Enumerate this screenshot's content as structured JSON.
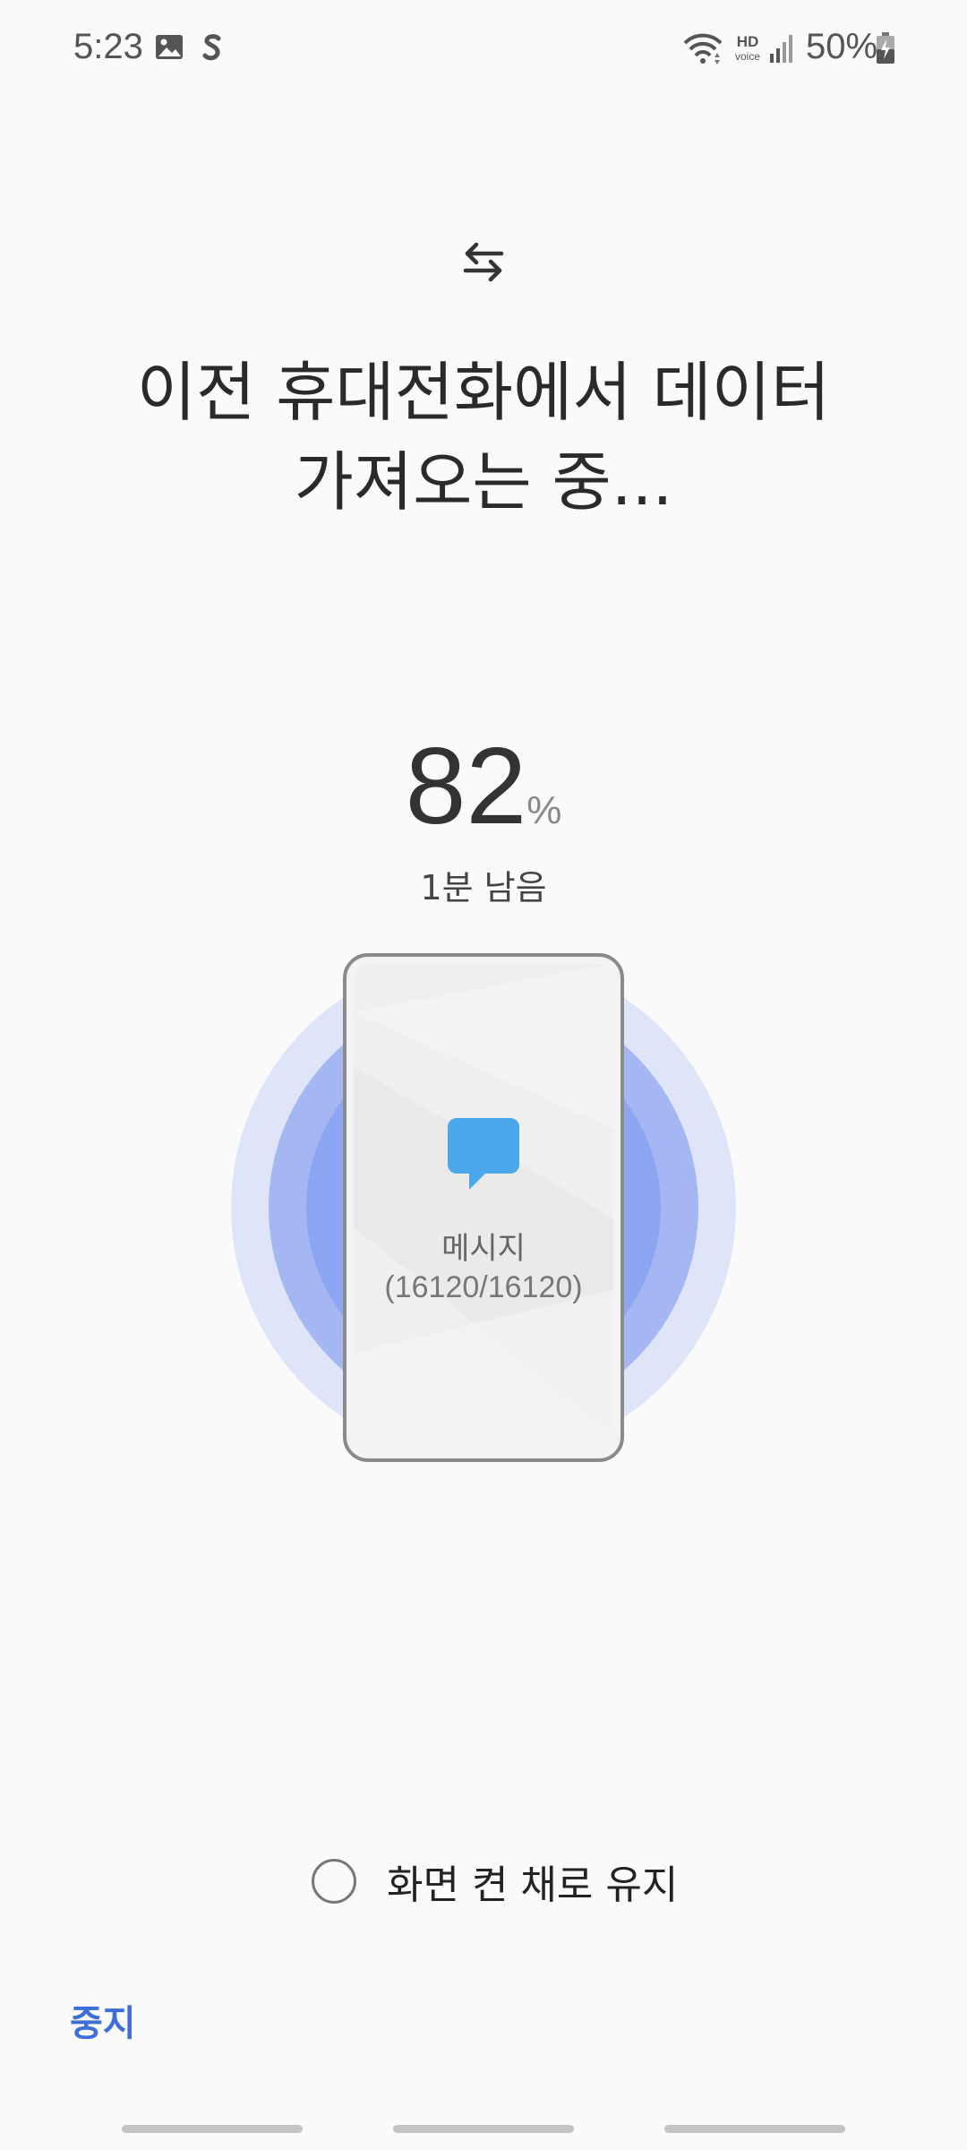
{
  "status_bar": {
    "time": "5:23",
    "battery": "50%",
    "icons": [
      "gallery-icon",
      "samsung-pay-icon",
      "wifi-icon",
      "hd-voice-icon",
      "signal-icon",
      "battery-charging-icon"
    ],
    "hd_label": "HD",
    "voice_label": "voice"
  },
  "header": {
    "icon": "transfer-arrows-icon",
    "title": "이전 휴대전화에서 데이터 가져오는 중..."
  },
  "progress": {
    "value": "82",
    "unit": "%",
    "remaining": "1분 남음"
  },
  "current_item": {
    "icon": "message-bubble-icon",
    "label": "메시지",
    "count": "(16120/16120)"
  },
  "options": {
    "keep_screen_on_label": "화면 켠 채로 유지",
    "keep_screen_on_checked": false
  },
  "actions": {
    "stop_label": "중지"
  },
  "colors": {
    "accent": "#3e6fd8",
    "message_icon": "#4aa8ea",
    "ring_outer": "#dfe5f8",
    "ring_mid": "#a5b7f2",
    "ring_inner": "#8ea5f2"
  }
}
